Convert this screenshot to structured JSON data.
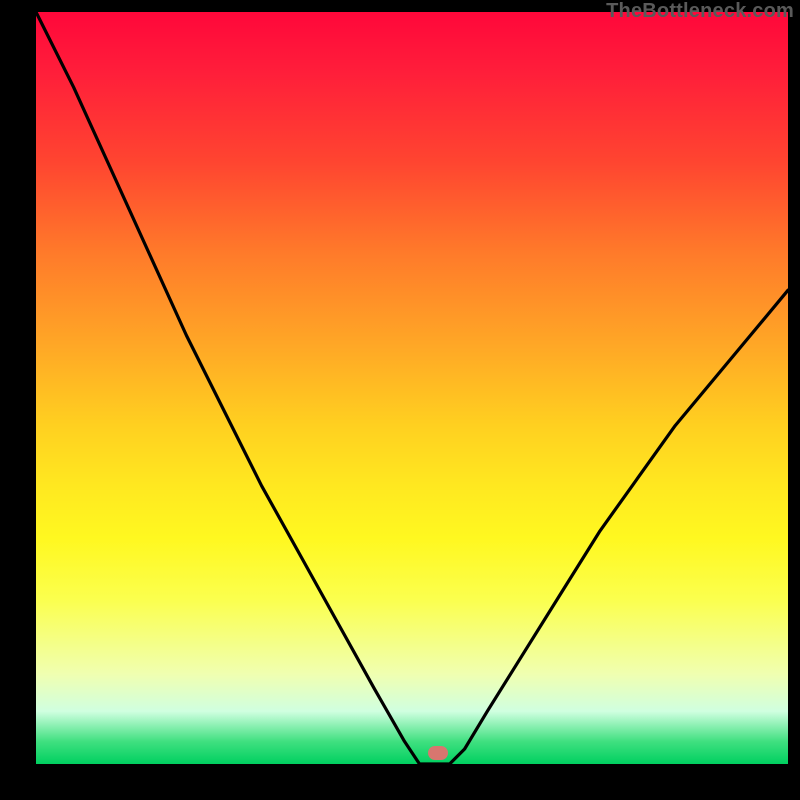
{
  "attribution": "TheBottleneck.com",
  "colors": {
    "top": "#ff073a",
    "mid": "#ffe820",
    "bottom": "#00d060",
    "curve": "#000000",
    "frame": "#000000",
    "marker": "#d8766f"
  },
  "marker": {
    "x_frac": 0.535,
    "y_frac": 0.985
  },
  "chart_data": {
    "type": "line",
    "title": "",
    "xlabel": "",
    "ylabel": "",
    "xlim": [
      0,
      1
    ],
    "ylim": [
      0,
      100
    ],
    "series": [
      {
        "name": "bottleneck-curve",
        "x": [
          0.0,
          0.05,
          0.1,
          0.15,
          0.2,
          0.25,
          0.3,
          0.35,
          0.4,
          0.45,
          0.49,
          0.51,
          0.55,
          0.57,
          0.6,
          0.65,
          0.7,
          0.75,
          0.8,
          0.85,
          0.9,
          0.95,
          1.0
        ],
        "y": [
          100,
          90,
          79,
          68,
          57,
          47,
          37,
          28,
          19,
          10,
          3,
          0,
          0,
          2,
          7,
          15,
          23,
          31,
          38,
          45,
          51,
          57,
          63
        ]
      }
    ]
  }
}
